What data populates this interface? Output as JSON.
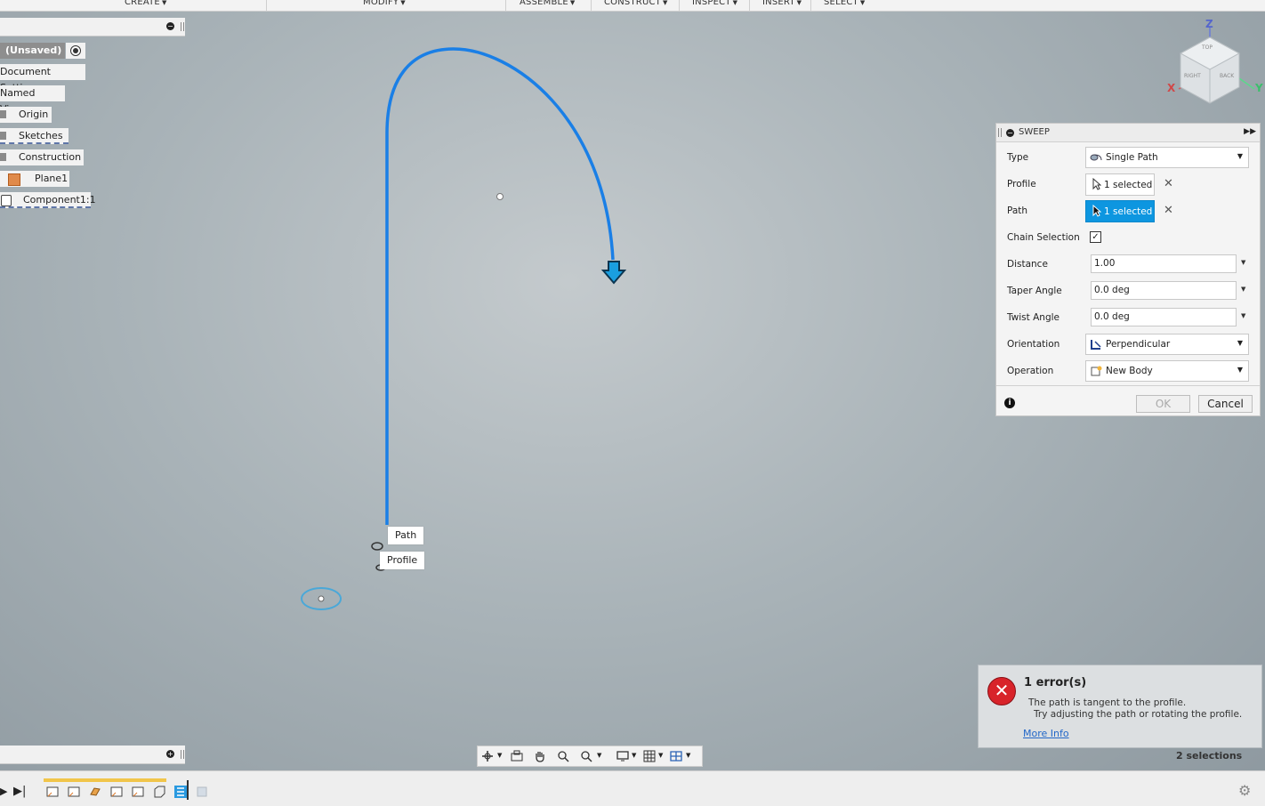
{
  "menu": {
    "items": [
      {
        "label": "CREATE"
      },
      {
        "label": "MODIFY"
      },
      {
        "label": "ASSEMBLE"
      },
      {
        "label": "CONSTRUCT"
      },
      {
        "label": "INSPECT"
      },
      {
        "label": "INSERT"
      },
      {
        "label": "SELECT"
      }
    ]
  },
  "browser": {
    "root": "(Unsaved)",
    "nodes": [
      "Document Settings",
      "Named Views",
      "Origin",
      "Sketches",
      "Construction",
      "Plane1",
      "Component1:1"
    ]
  },
  "viewcube": {
    "z": "Z",
    "x": "X",
    "y": "Y",
    "top": "TOP",
    "right": "RIGHT",
    "back": "BACK"
  },
  "sweep": {
    "title": "SWEEP",
    "type_label": "Type",
    "type_value": "Single Path",
    "profile_label": "Profile",
    "profile_value": "1 selected",
    "path_label": "Path",
    "path_value": "1 selected",
    "chain_label": "Chain Selection",
    "chain_checked": "✓",
    "distance_label": "Distance",
    "distance_value": "1.00",
    "taper_label": "Taper Angle",
    "taper_value": "0.0 deg",
    "twist_label": "Twist Angle",
    "twist_value": "0.0 deg",
    "orientation_label": "Orientation",
    "orientation_value": "Perpendicular",
    "operation_label": "Operation",
    "operation_value": "New Body",
    "ok_label": "OK",
    "cancel_label": "Cancel"
  },
  "canvas": {
    "path_tag": "Path",
    "profile_tag": "Profile",
    "path_color": "#1a7fe6"
  },
  "error": {
    "title": "1 error(s)",
    "line1": "The path is tangent to the profile.",
    "line2": "Try adjusting the path or rotating the profile.",
    "link": "More Info"
  },
  "status": {
    "selections": "2 selections"
  }
}
